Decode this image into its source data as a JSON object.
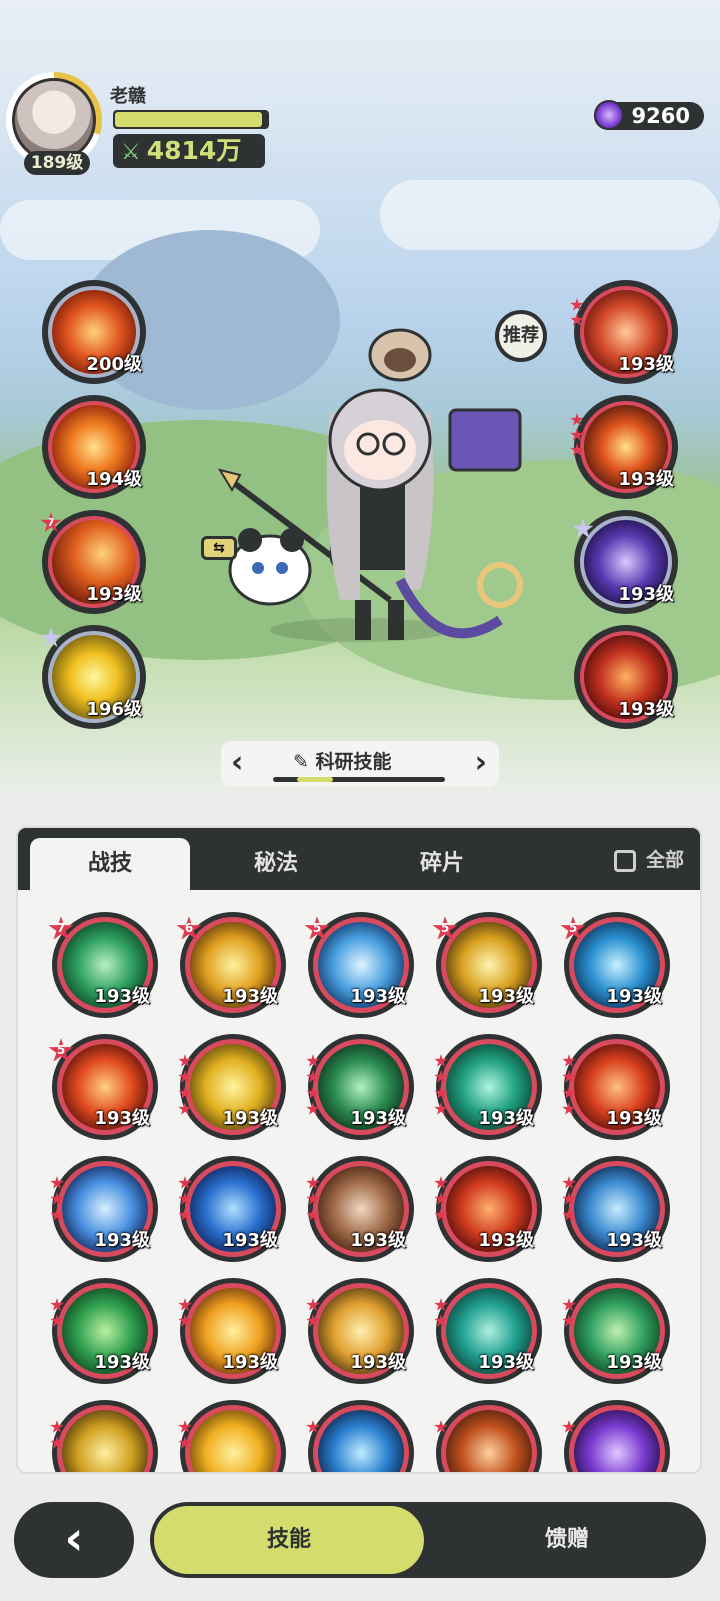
{
  "player": {
    "name": "老赣",
    "level": "189级",
    "power": "4814万",
    "hp_fraction": 0.97
  },
  "currency": {
    "icon": "purple-gem-icon",
    "amount": "9260"
  },
  "recommend_label": "推荐",
  "left_skills": [
    {
      "level": "200级",
      "icon": "lava-burst-icon",
      "star": null
    },
    {
      "level": "194级",
      "icon": "fire-swirl-icon",
      "star": null
    },
    {
      "level": "193级",
      "icon": "meteor-icon",
      "star": "7"
    },
    {
      "level": "196级",
      "icon": "lightning-orb-icon",
      "star": "white"
    }
  ],
  "right_skills": [
    {
      "level": "193级",
      "icon": "flame-spirit-icon",
      "stars": 3
    },
    {
      "level": "193级",
      "icon": "fire-ring-icon",
      "stars": 3
    },
    {
      "level": "193级",
      "icon": "arcane-clock-icon",
      "star": "white"
    },
    {
      "level": "193级",
      "icon": "fire-beast-icon",
      "stars": 0
    }
  ],
  "switcher": {
    "title": "科研技能",
    "prev": "‹",
    "next": "›"
  },
  "tabs": [
    {
      "label": "战技",
      "active": true
    },
    {
      "label": "秘法",
      "active": false
    },
    {
      "label": "碎片",
      "active": false
    }
  ],
  "all_label": "全部",
  "grid": [
    {
      "level": "193级",
      "star": "7",
      "icon": "green-wind-icon"
    },
    {
      "level": "193级",
      "star": "6",
      "icon": "golden-burst-icon"
    },
    {
      "level": "193级",
      "star": "5",
      "icon": "ice-shatter-icon"
    },
    {
      "level": "193级",
      "star": "5",
      "icon": "holy-crystal-icon"
    },
    {
      "level": "193级",
      "star": "5",
      "icon": "water-vortex-icon"
    },
    {
      "level": "193级",
      "star": "5",
      "icon": "fire-blaze-icon"
    },
    {
      "level": "193级",
      "pips": 4,
      "icon": "golden-spark-icon"
    },
    {
      "level": "193级",
      "pips": 4,
      "icon": "thorn-vine-icon"
    },
    {
      "level": "193级",
      "pips": 4,
      "icon": "green-vortex-icon"
    },
    {
      "level": "193级",
      "pips": 4,
      "icon": "flame-wave-icon"
    },
    {
      "level": "193级",
      "pips": 3,
      "icon": "ice-crystal-icon"
    },
    {
      "level": "193级",
      "pips": 3,
      "icon": "blue-flame-icon"
    },
    {
      "level": "193级",
      "pips": 3,
      "icon": "rune-card-icon"
    },
    {
      "level": "193级",
      "pips": 3,
      "icon": "fire-tornado-icon"
    },
    {
      "level": "193级",
      "pips": 3,
      "icon": "ice-shard-icon"
    },
    {
      "level": "193级",
      "pips": 2,
      "icon": "green-claw-icon"
    },
    {
      "level": "193级",
      "pips": 2,
      "icon": "sun-orb-icon"
    },
    {
      "level": "193级",
      "pips": 2,
      "icon": "shooting-star-icon"
    },
    {
      "level": "193级",
      "pips": 2,
      "icon": "teal-swirl-icon"
    },
    {
      "level": "193级",
      "pips": 2,
      "icon": "leaf-blade-icon"
    },
    {
      "level": "",
      "pips": 2,
      "icon": "thunder-icon"
    },
    {
      "level": "",
      "pips": 2,
      "icon": "sunrise-icon"
    },
    {
      "level": "",
      "pips": 1,
      "icon": "water-splash-icon"
    },
    {
      "level": "",
      "pips": 1,
      "icon": "rock-fire-icon"
    },
    {
      "level": "",
      "pips": 1,
      "icon": "void-orb-icon"
    }
  ],
  "nav": {
    "back": "‹",
    "skills": "技能",
    "gift": "馈赠"
  },
  "colors": {
    "accent": "#d5dc6e",
    "dark": "#2f3233",
    "ring": "#d84a5e"
  }
}
